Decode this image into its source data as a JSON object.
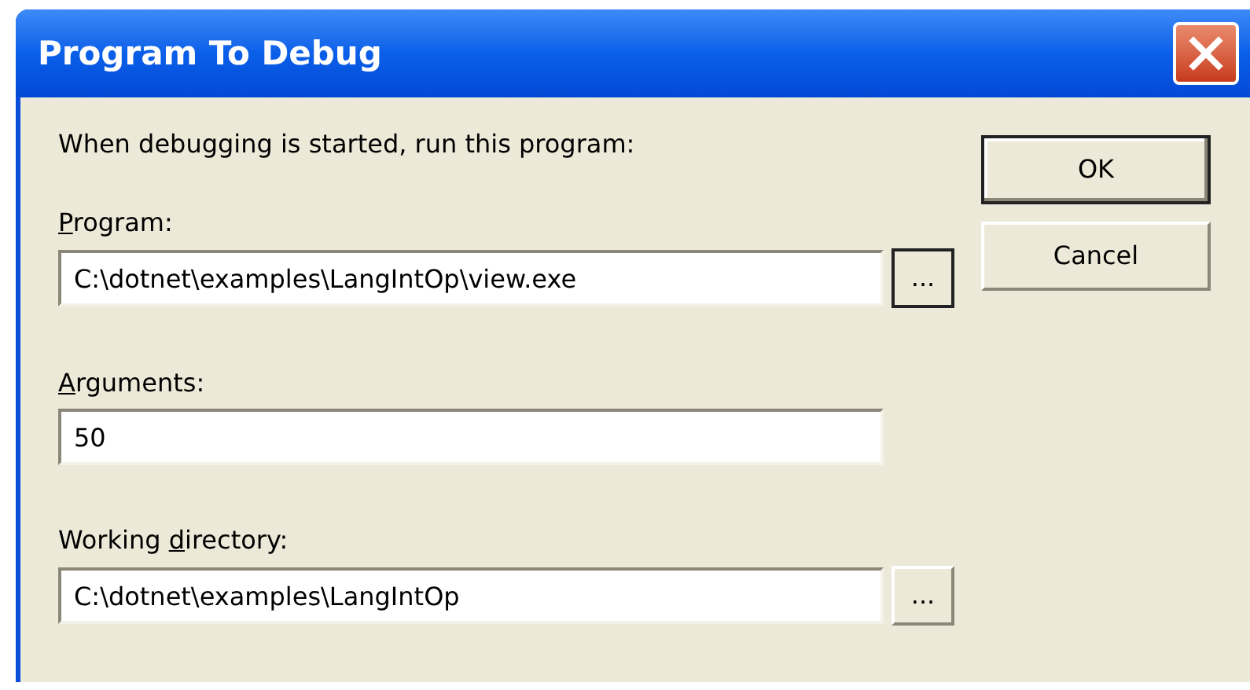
{
  "window": {
    "title": "Program To Debug"
  },
  "intro": "When debugging is started, run this program:",
  "fields": [
    {
      "label": {
        "key": "P",
        "after": "rogram:"
      },
      "value": "C:\\dotnet\\examples\\LangIntOp\\view.exe",
      "browse": {
        "label": "...",
        "focused": true
      }
    },
    {
      "label": {
        "key": "A",
        "after": "rguments:"
      },
      "value": "50"
    },
    {
      "label": {
        "before": "Working ",
        "key": "d",
        "after": "irectory:"
      },
      "value": "C:\\dotnet\\examples\\LangIntOp",
      "browse": {
        "label": "...",
        "focused": false
      }
    }
  ],
  "buttons": [
    {
      "label": "OK",
      "default": true
    },
    {
      "label": "Cancel",
      "default": false
    }
  ]
}
